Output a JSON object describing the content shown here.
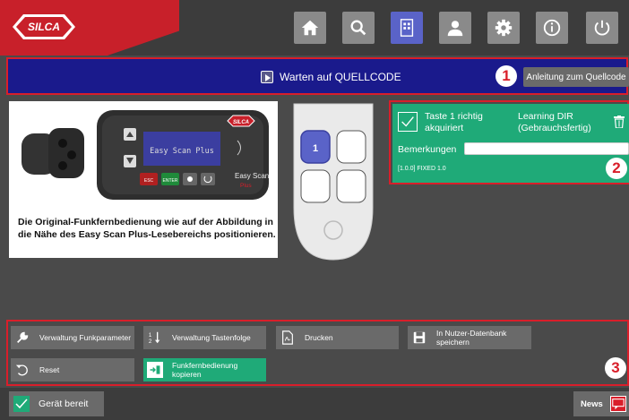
{
  "brand": {
    "logo_text": "SILCA",
    "accent": "#c8202a"
  },
  "nav": [
    {
      "name": "home-icon"
    },
    {
      "name": "search-icon"
    },
    {
      "name": "documents-icon",
      "active": true
    },
    {
      "name": "user-icon"
    },
    {
      "name": "gear-icon"
    },
    {
      "name": "info-icon"
    },
    {
      "name": "power-icon"
    }
  ],
  "status": {
    "text": "Warten auf QUELLCODE",
    "badge": "1",
    "guide_button": "Anleitung zum Quellcode"
  },
  "device": {
    "screen_text": "Easy Scan Plus",
    "brand": "Easy Scan",
    "brand_sub": "Plus",
    "esc": "ESC",
    "enter": "ENTER"
  },
  "instruction": "Die Original-Funkfernbedienung wie auf der Abbildung in die Nähe des Easy Scan Plus-Lesebereichs positionieren.",
  "remote": {
    "active_button": "1"
  },
  "result": {
    "title": "Taste 1 richtig akquiriert",
    "learning": "Learning DIR (Gebrauchsfertig)",
    "remarks_label": "Bemerkungen",
    "remarks_value": "",
    "firmware": "[1.0.0] FIXED 1.0",
    "badge": "2"
  },
  "actions": {
    "badge": "3",
    "radio_params": "Verwaltung Funkparameter",
    "key_sequence": "Verwaltung Tastenfolge",
    "print": "Drucken",
    "save_db": "In Nutzer-Datenbank speichern",
    "reset": "Reset",
    "copy_remote": "Funkfernbedienung kopieren"
  },
  "footer": {
    "ready": "Gerät bereit",
    "news": "News"
  },
  "colors": {
    "status_blue": "#1a1a8c",
    "success_green": "#1faa78",
    "highlight_red": "#d91e2a",
    "active_nav": "#5a63c8"
  }
}
